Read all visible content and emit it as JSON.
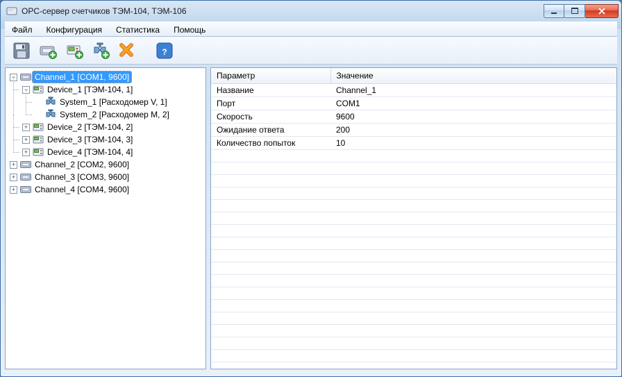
{
  "window": {
    "title": "OPC-сервер счетчиков ТЭМ-104, ТЭМ-106"
  },
  "menu": {
    "items": [
      "Файл",
      "Конфигурация",
      "Статистика",
      "Помощь"
    ]
  },
  "toolbar": {
    "buttons": [
      {
        "name": "save",
        "icon": "floppy"
      },
      {
        "name": "add-channel",
        "icon": "port-add"
      },
      {
        "name": "add-device",
        "icon": "device-add"
      },
      {
        "name": "add-system",
        "icon": "valve-add"
      },
      {
        "name": "delete",
        "icon": "delete-x"
      },
      {
        "name": "help",
        "icon": "help-q"
      }
    ]
  },
  "tree": {
    "root_toggle": "−",
    "nodes": [
      {
        "label": "Channel_1 [COM1, 9600]",
        "icon": "port",
        "selected": true,
        "toggle": "−",
        "children": [
          {
            "label": "Device_1 [ТЭМ-104, 1]",
            "icon": "device",
            "toggle": "−",
            "children": [
              {
                "label": "System_1 [Расходомер V, 1]",
                "icon": "valve"
              },
              {
                "label": "System_2 [Расходомер M, 2]",
                "icon": "valve"
              }
            ]
          },
          {
            "label": "Device_2 [ТЭМ-104, 2]",
            "icon": "device",
            "toggle": "+"
          },
          {
            "label": "Device_3 [ТЭМ-104, 3]",
            "icon": "device",
            "toggle": "+"
          },
          {
            "label": "Device_4 [ТЭМ-104, 4]",
            "icon": "device",
            "toggle": "+"
          }
        ]
      },
      {
        "label": "Channel_2 [COM2, 9600]",
        "icon": "port",
        "toggle": "+"
      },
      {
        "label": "Channel_3 [COM3, 9600]",
        "icon": "port",
        "toggle": "+"
      },
      {
        "label": "Channel_4 [COM4, 9600]",
        "icon": "port",
        "toggle": "+"
      }
    ]
  },
  "params": {
    "headers": {
      "name": "Параметр",
      "value": "Значение"
    },
    "rows": [
      {
        "name": "Название",
        "value": "Channel_1"
      },
      {
        "name": "Порт",
        "value": "COM1"
      },
      {
        "name": "Скорость",
        "value": "9600"
      },
      {
        "name": "Ожидание ответа",
        "value": "200"
      },
      {
        "name": "Количество попыток",
        "value": "10"
      }
    ]
  }
}
